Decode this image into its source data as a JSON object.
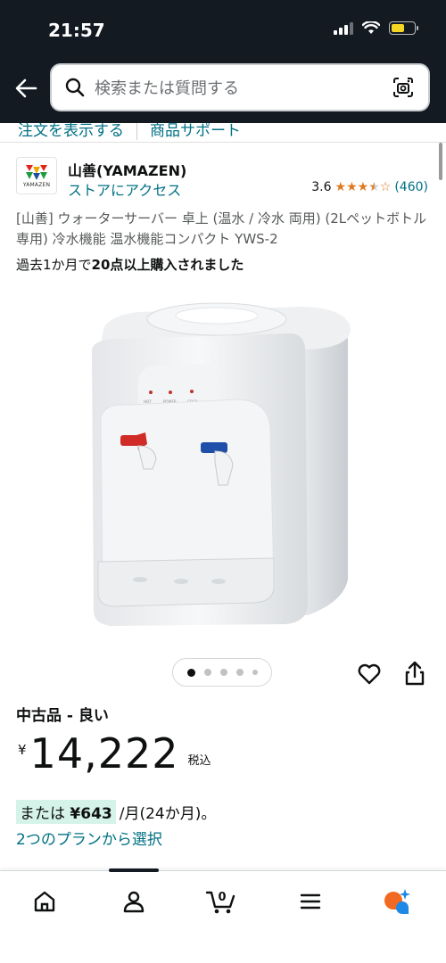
{
  "status_bar": {
    "time": "21:57"
  },
  "search": {
    "placeholder": "検索または質問する"
  },
  "subnav": {
    "items": [
      "注文を表示する",
      "商品サポート"
    ]
  },
  "brand": {
    "name": "山善(YAMAZEN)",
    "store_link": "ストアにアクセス",
    "logo_text": "YAMAZEN"
  },
  "rating": {
    "value": "3.6",
    "stars": 3.6,
    "count": "(460)",
    "star_color": "#de7921"
  },
  "product": {
    "title": "[山善] ウォーターサーバー 卓上 (温水 / 冷水 両用) (2Lペットボトル専用) 冷水機能 温水機能コンパクト YWS-2",
    "bought_prefix": "過去1か月で",
    "bought_bold": "20点以上購入されました",
    "panel_labels": [
      "HOT",
      "POWER",
      "COLD"
    ]
  },
  "carousel": {
    "count": 5,
    "active": 0
  },
  "offer": {
    "condition": "中古品 - 良い",
    "price_symbol": "¥",
    "price": "14,222",
    "tax": "税込",
    "monthly_prefix": "または",
    "monthly_amount": "¥643",
    "monthly_suffix": "/月(24か月)。",
    "plans_link": "2つのプランから選択"
  },
  "bottom_nav": {
    "cart_count": "0",
    "items": [
      "home-icon",
      "account-icon",
      "cart-icon",
      "menu-icon",
      "rufus-icon"
    ]
  },
  "colors": {
    "header": "#131a22",
    "link": "#007185",
    "highlight": "#d5f3e8",
    "star": "#de7921"
  }
}
